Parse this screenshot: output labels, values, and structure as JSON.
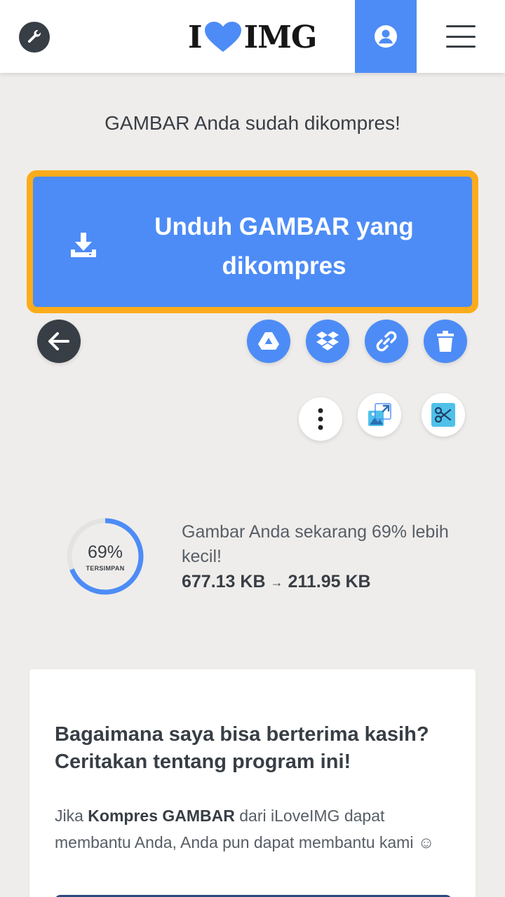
{
  "header": {
    "logo_left": "I",
    "logo_right": "IMG",
    "tools_icon": "wrench-icon",
    "user_icon": "user-circle-icon",
    "menu_icon": "hamburger-menu-icon"
  },
  "main": {
    "success_message": "GAMBAR Anda sudah dikompres!",
    "download_button_label": "Unduh GAMBAR yang dikompres"
  },
  "actions": {
    "back": "arrow-left-icon",
    "google_drive": "google-drive-icon",
    "dropbox": "dropbox-icon",
    "link": "link-icon",
    "delete": "trash-icon",
    "more": "more-vertical-icon",
    "resize": "resize-image-icon",
    "crop": "crop-scissors-icon"
  },
  "stats": {
    "percent": "69%",
    "percent_value": 69,
    "saved_label": "TERSIMPAN",
    "message": "Gambar Anda sekarang 69% lebih kecil!",
    "size_from": "677.13 KB",
    "size_to": "211.95 KB"
  },
  "card": {
    "title": "Bagaimana saya bisa berterima kasih? Ceritakan tentang program ini!",
    "text_prefix": "Jika ",
    "text_bold": "Kompres GAMBAR",
    "text_suffix": " dari iLoveIMG dapat membantu Anda, Anda pun dapat membantu kami ",
    "emoji": "☺"
  },
  "colors": {
    "accent": "#4d8cf6",
    "highlight": "#fbac1c",
    "dark": "#383e45",
    "background": "#efedeb",
    "ring_track": "#e3e3e3"
  }
}
